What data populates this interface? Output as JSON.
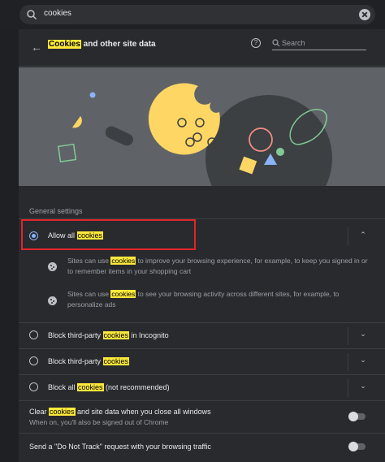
{
  "search": {
    "value": "cookies"
  },
  "header": {
    "title_highlight": "Cookies",
    "title_rest": " and other site data",
    "search_placeholder": "Search"
  },
  "general_settings": {
    "label": "General settings"
  },
  "options": [
    {
      "label_prefix": "Allow all ",
      "label_highlight": "cookies",
      "label_suffix": "",
      "selected": true,
      "expanded": true,
      "details": [
        {
          "prefix": "Sites can use ",
          "highlight": "cookies",
          "suffix": " to improve your browsing experience, for example, to keep you signed in or to remember items in your shopping cart"
        },
        {
          "prefix": "Sites can use ",
          "highlight": "cookies",
          "suffix": " to see your browsing activity across different sites, for example, to personalize ads"
        }
      ]
    },
    {
      "label_prefix": "Block third-party ",
      "label_highlight": "cookies",
      "label_suffix": " in Incognito",
      "selected": false
    },
    {
      "label_prefix": "Block third-party ",
      "label_highlight": "cookies",
      "label_suffix": "",
      "selected": false
    },
    {
      "label_prefix": "Block all ",
      "label_highlight": "cookies",
      "label_suffix": " (not recommended)",
      "selected": false
    }
  ],
  "clear_on_exit": {
    "label_prefix": "Clear ",
    "label_highlight": "cookies",
    "label_suffix": " and site data when you close all windows",
    "sublabel": "When on, you'll also be signed out of Chrome",
    "enabled": false
  },
  "do_not_track": {
    "label": "Send a \"Do Not Track\" request with your browsing traffic",
    "enabled": false
  },
  "colors": {
    "highlight": "#fde93a",
    "accent": "#8ab4f8",
    "annotation_box": "#e0252b",
    "illustration_cookie": "#fdd663"
  }
}
